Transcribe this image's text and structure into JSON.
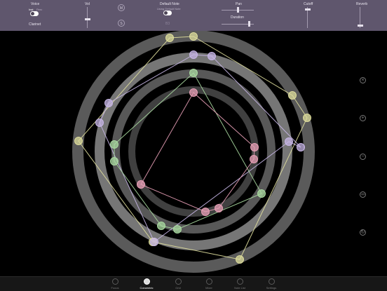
{
  "toolbar": {
    "voice": {
      "label": "Voice",
      "insts_label": "Inst",
      "perc_label": "Perc",
      "instrument": "Clarinet"
    },
    "vol": {
      "label": "Vol",
      "level": 0.45
    },
    "mute_label": "M",
    "solo_label": "S",
    "default_note": {
      "label": "Default Note",
      "sub_label": "Using Default Note",
      "value": "B3"
    },
    "pan": {
      "label": "Pan",
      "level": 0.5
    },
    "duration": {
      "label": "Duration",
      "level": 0.85
    },
    "cutoff": {
      "label": "Cutoff",
      "level": 0.9
    },
    "reverb": {
      "label": "Reverb",
      "level": 0.15
    }
  },
  "rings": [
    {
      "name": "ring-outer",
      "color": "#dedd9c"
    },
    {
      "name": "ring-2",
      "color": "#c7b6e6"
    },
    {
      "name": "ring-3",
      "color": "#a9d9a0"
    },
    {
      "name": "ring-inner",
      "color": "#e79fb6"
    }
  ],
  "side_icons": [
    {
      "name": "close-icon",
      "glyph": "×"
    },
    {
      "name": "plus-icon",
      "glyph": "+"
    },
    {
      "name": "minus-icon",
      "glyph": "−"
    },
    {
      "name": "link-icon",
      "glyph": "∞"
    },
    {
      "name": "refresh-icon",
      "glyph": "↻"
    }
  ],
  "tabs": [
    {
      "label": "Focus",
      "active": false
    },
    {
      "label": "Concentric",
      "active": true
    },
    {
      "label": "Grid",
      "active": false
    },
    {
      "label": "Mixer",
      "active": false
    },
    {
      "label": "Note List",
      "active": false
    },
    {
      "label": "Settings",
      "active": false
    }
  ]
}
